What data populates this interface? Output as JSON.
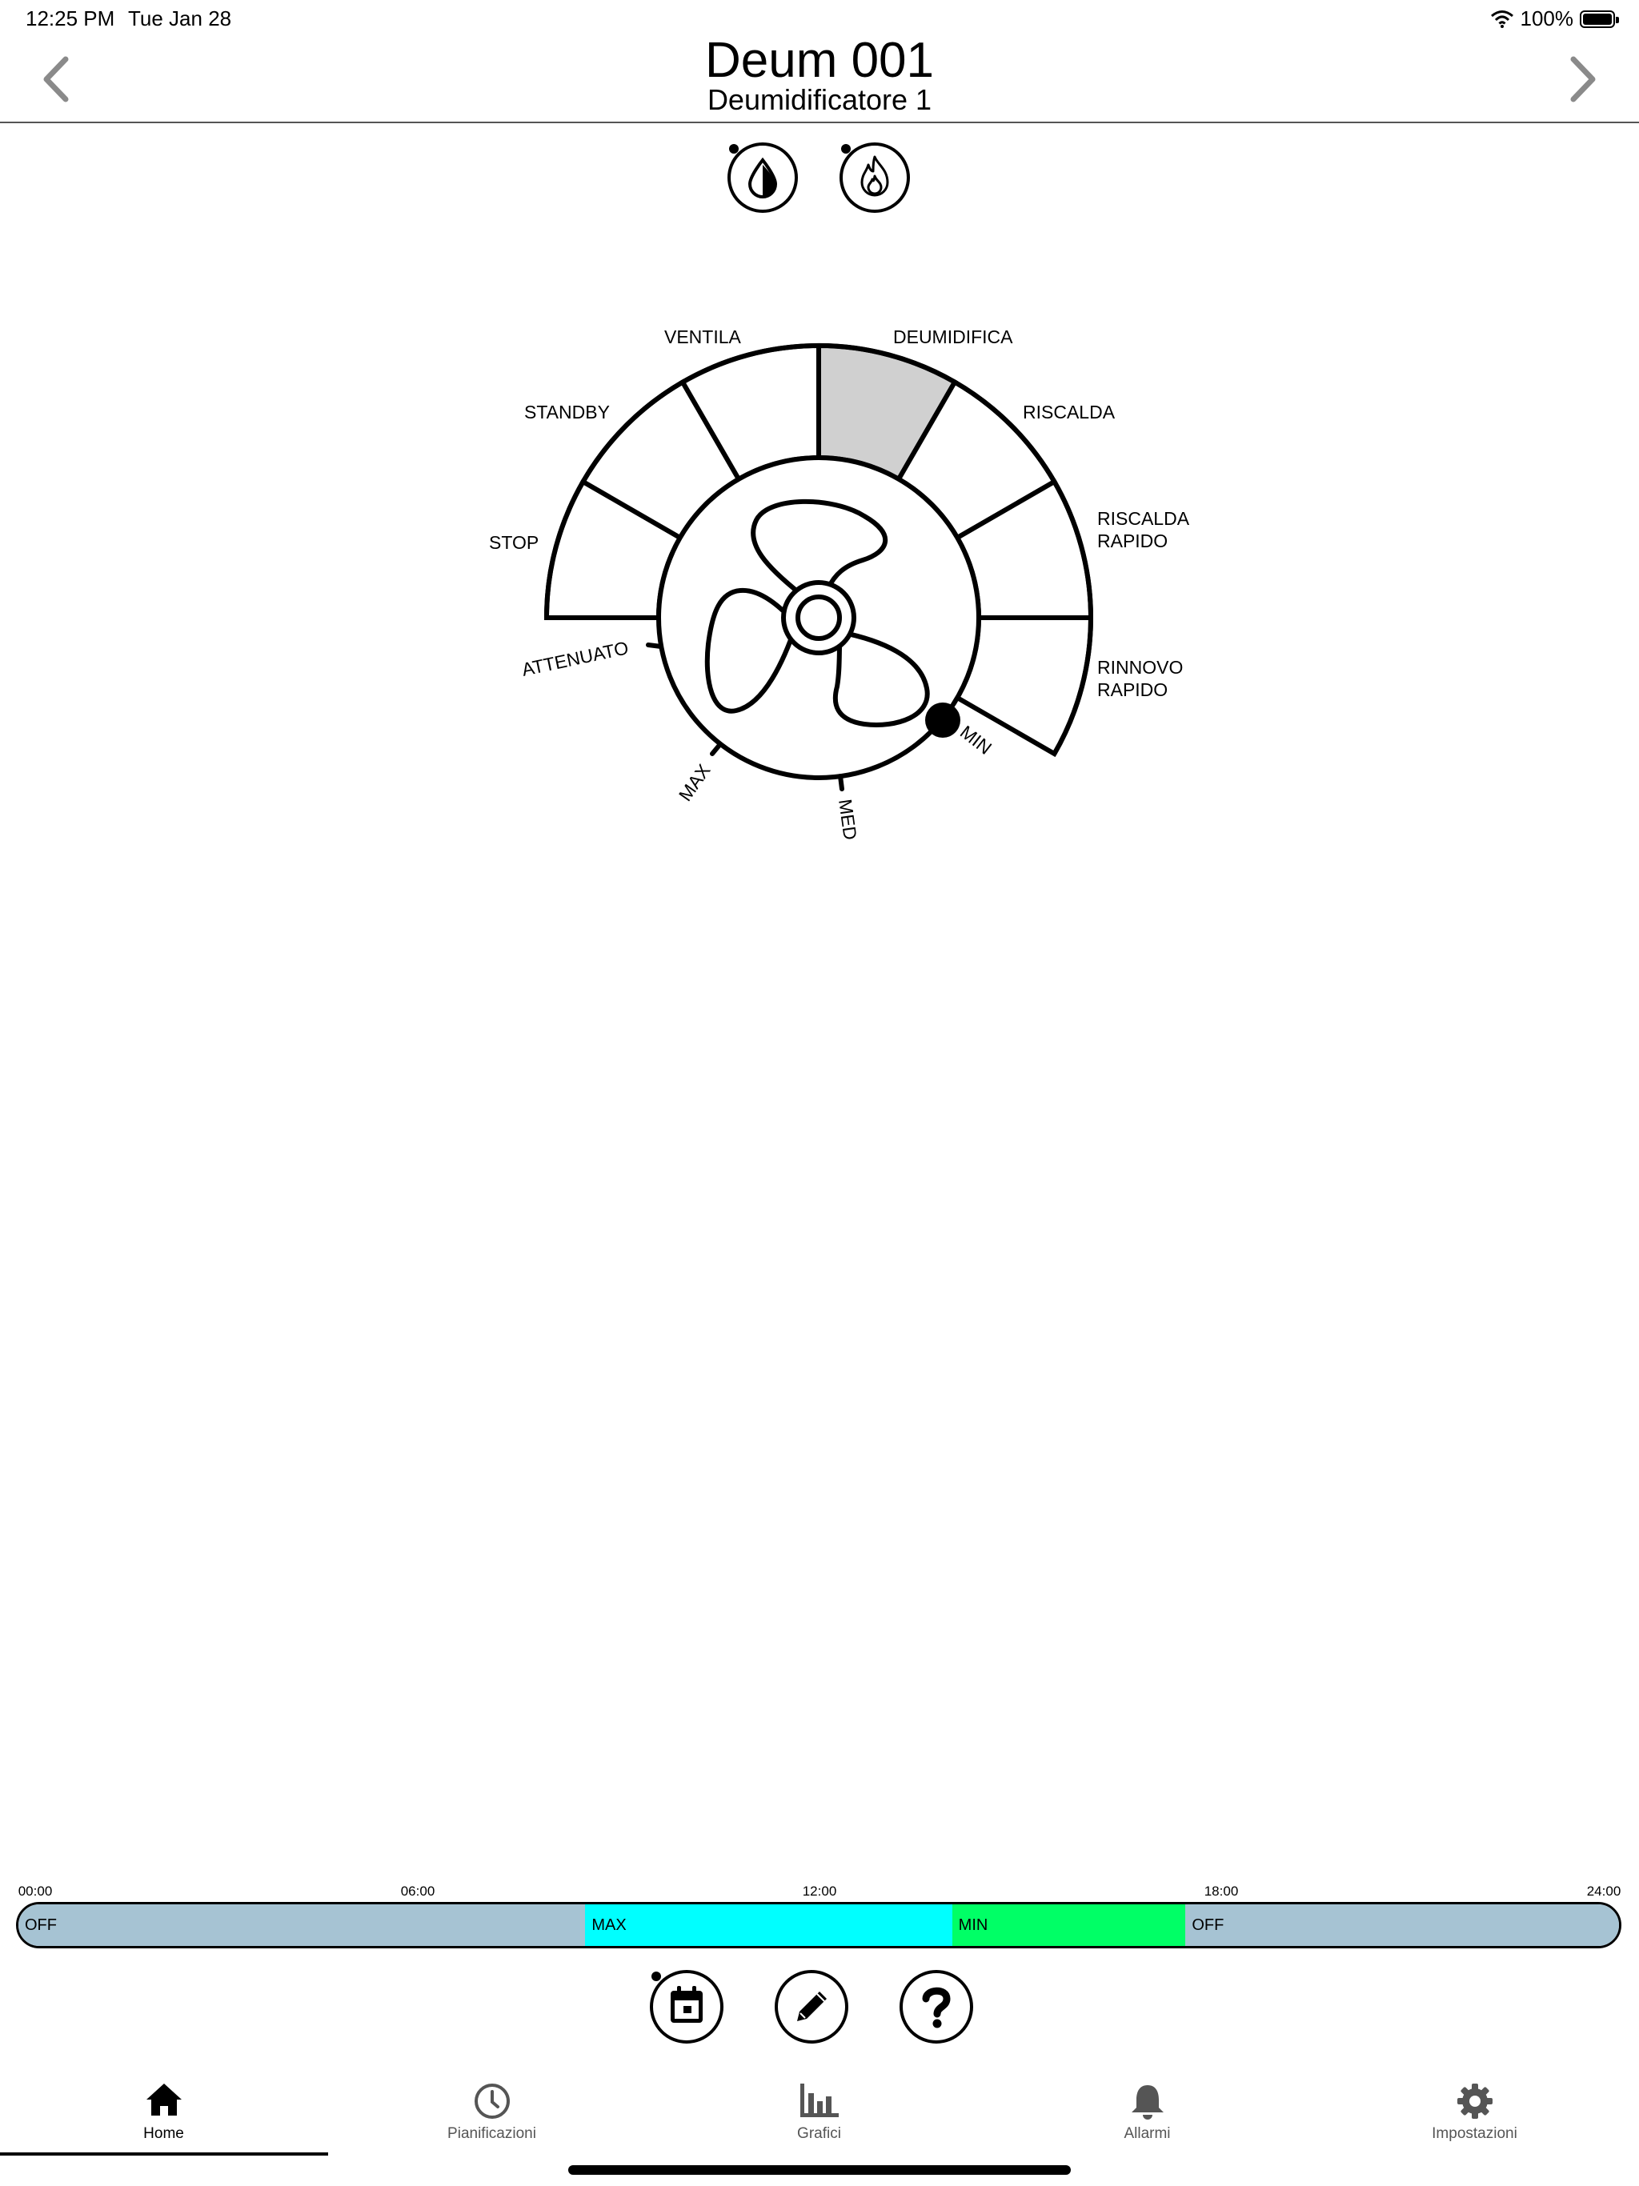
{
  "status_bar": {
    "time": "12:25 PM",
    "date": "Tue Jan 28",
    "battery": "100%"
  },
  "header": {
    "title": "Deum 001",
    "subtitle": "Deumidificatore 1"
  },
  "mode_buttons": [
    {
      "name": "dehumidify-mode",
      "icon": "water-drop-icon"
    },
    {
      "name": "heat-mode",
      "icon": "flame-icon"
    }
  ],
  "dial": {
    "modes": [
      "STOP",
      "STANDBY",
      "VENTILA",
      "DEUMIDIFICA",
      "RISCALDA",
      "RISCALDA\nRAPIDO",
      "RINNOVO\nRAPIDO"
    ],
    "labels": {
      "stop": "STOP",
      "standby": "STANDBY",
      "ventila": "VENTILA",
      "deumidifica": "DEUMIDIFICA",
      "riscalda": "RISCALDA",
      "riscalda_rapido_1": "RISCALDA",
      "riscalda_rapido_2": "RAPIDO",
      "rinnovo_rapido_1": "RINNOVO",
      "rinnovo_rapido_2": "RAPIDO"
    },
    "selected_mode": "DEUMIDIFICA",
    "speed_levels": {
      "attenuato": "ATTENUATO",
      "max": "MAX",
      "med": "MED",
      "min": "MIN"
    },
    "selected_speed": "MIN",
    "selected_color": "#d0d0d0"
  },
  "timeline": {
    "ticks": [
      "00:00",
      "06:00",
      "12:00",
      "18:00",
      "24:00"
    ],
    "segments": [
      {
        "label": "OFF",
        "start": 0,
        "end": 8.5,
        "color": "#a6c3d3"
      },
      {
        "label": "MAX",
        "start": 8.5,
        "end": 14.0,
        "color": "#00ffff"
      },
      {
        "label": "MIN",
        "start": 14.0,
        "end": 17.5,
        "color": "#00ff66"
      },
      {
        "label": "OFF",
        "start": 17.5,
        "end": 24,
        "color": "#a6c3d3"
      }
    ]
  },
  "actions": [
    {
      "name": "calendar-button",
      "icon": "calendar-icon"
    },
    {
      "name": "edit-button",
      "icon": "pencil-icon"
    },
    {
      "name": "help-button",
      "icon": "question-icon"
    }
  ],
  "tabs": [
    {
      "label": "Home",
      "icon": "home-icon",
      "active": true
    },
    {
      "label": "Pianificazioni",
      "icon": "clock-icon",
      "active": false
    },
    {
      "label": "Grafici",
      "icon": "bar-chart-icon",
      "active": false
    },
    {
      "label": "Allarmi",
      "icon": "bell-icon",
      "active": false
    },
    {
      "label": "Impostazioni",
      "icon": "gear-icon",
      "active": false
    }
  ]
}
